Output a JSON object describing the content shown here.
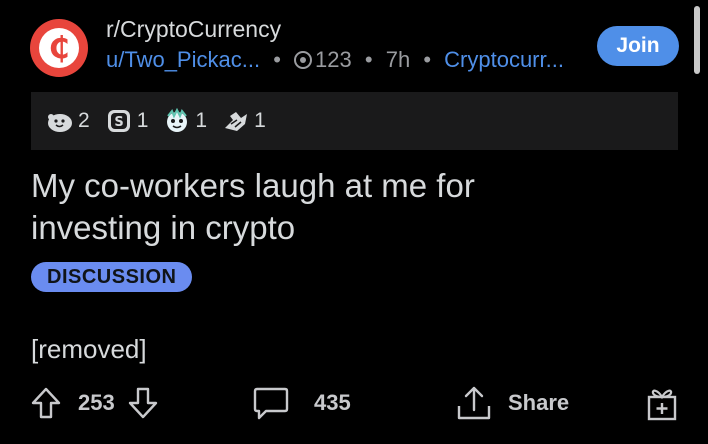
{
  "post": {
    "subreddit": "r/CryptoCurrency",
    "author": "u/Two_Pickac...",
    "karma": "123",
    "age": "7h",
    "user_flair": "Cryptocurr...",
    "join_label": "Join",
    "awards": [
      {
        "icon": "wholesome-award-icon",
        "count": "2"
      },
      {
        "icon": "silver-award-icon",
        "count": "1"
      },
      {
        "icon": "helpful-award-icon",
        "count": "1"
      },
      {
        "icon": "take-my-energy-award-icon",
        "count": "1"
      }
    ],
    "title": "My co-workers laugh at me for investing in crypto",
    "post_flair": "DISCUSSION",
    "body": "[removed]",
    "upvotes": "253",
    "comments": "435",
    "share_label": "Share"
  },
  "colors": {
    "background": "#000000",
    "subreddit_icon": "#e8453c",
    "accent_blue": "#4f8fe8",
    "flair_bg": "#6a8cf0",
    "awards_bar": "#1a1a1b"
  }
}
